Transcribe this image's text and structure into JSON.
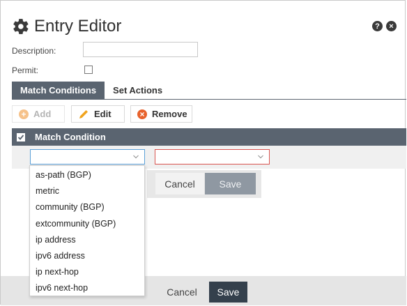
{
  "dialog": {
    "title": "Entry Editor",
    "help_icon": "?",
    "close_icon": "×"
  },
  "form": {
    "description_label": "Description:",
    "description_value": "",
    "permit_label": "Permit:",
    "permit_checked": false
  },
  "tabs": [
    {
      "label": "Match Conditions",
      "active": true
    },
    {
      "label": "Set Actions",
      "active": false
    }
  ],
  "toolbar": {
    "add_label": "Add",
    "edit_label": "Edit",
    "remove_label": "Remove"
  },
  "table": {
    "header_label": "Match Condition"
  },
  "inline_controls": {
    "cancel_label": "Cancel",
    "save_label": "Save"
  },
  "dropdown": {
    "options": [
      "as-path (BGP)",
      "metric",
      "community (BGP)",
      "extcommunity (BGP)",
      "ip address",
      "ipv6 address",
      "ip next-hop",
      "ipv6 next-hop"
    ]
  },
  "footer": {
    "cancel_label": "Cancel",
    "save_label": "Save"
  },
  "colors": {
    "header_bg": "#5a6470",
    "save_dark": "#34404c",
    "add_icon": "#f6c28a",
    "remove_icon": "#e8622c",
    "edit_icon": "#f0a31d",
    "select_focus": "#5aa0d8",
    "select_error": "#d9534f"
  }
}
